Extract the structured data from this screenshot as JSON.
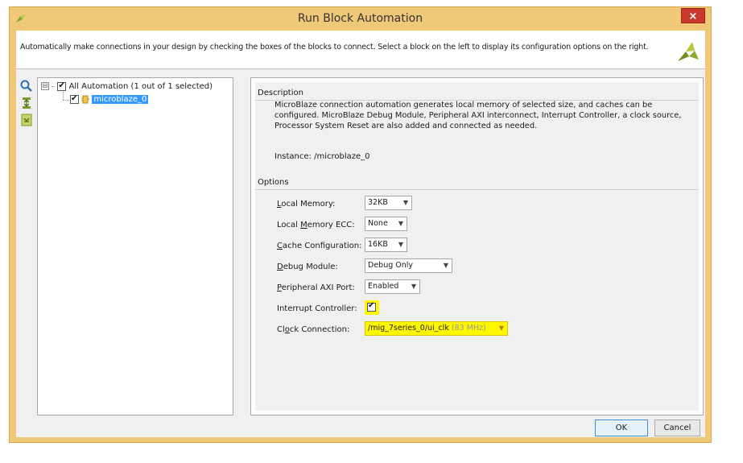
{
  "window": {
    "title": "Run Block Automation",
    "close_glyph": "×"
  },
  "banner": {
    "text": "Automatically make connections in your design by checking the boxes of the blocks to connect. Select a block on the left to display its configuration options on the right."
  },
  "toolbar": {
    "icons": [
      "search-icon",
      "expand-all-icon",
      "collapse-all-icon"
    ]
  },
  "tree": {
    "root": {
      "label": "All Automation (1 out of 1 selected)",
      "checked": true,
      "expander": "⊟"
    },
    "child": {
      "label": "microblaze_0",
      "checked": true
    }
  },
  "description": {
    "heading": "Description",
    "text": "MicroBlaze connection automation generates local memory of selected size, and caches can be configured. MicroBlaze Debug Module, Peripheral AXI interconnect, Interrupt Controller, a clock source, Processor System Reset are also added and connected as needed.",
    "instance": "Instance: /microblaze_0"
  },
  "options": {
    "heading": "Options",
    "local_memory": {
      "pre": "",
      "u": "L",
      "post": "ocal Memory:",
      "value": "32KB"
    },
    "local_memory_ecc": {
      "pre": "Local ",
      "u": "M",
      "post": "emory ECC:",
      "value": "None"
    },
    "cache_configuration": {
      "pre": "",
      "u": "C",
      "post": "ache Configuration:",
      "value": "16KB"
    },
    "debug_module": {
      "pre": "",
      "u": "D",
      "post": "ebug Module:",
      "value": "Debug Only"
    },
    "peripheral_axi_port": {
      "pre": "",
      "u": "P",
      "post": "eripheral AXI Port:",
      "value": "Enabled"
    },
    "interrupt_controller": {
      "label": "Interrupt Controller:",
      "checked": true
    },
    "clock_connection": {
      "pre": "Cl",
      "u": "o",
      "post": "ck Connection:",
      "value": "/mig_7series_0/ui_clk",
      "freq": "(83 MHz)"
    }
  },
  "buttons": {
    "ok": "OK",
    "cancel": "Cancel"
  },
  "colors": {
    "frame": "#f0c978",
    "selection": "#3399ff",
    "highlight": "#fff700",
    "close": "#c9392e"
  }
}
